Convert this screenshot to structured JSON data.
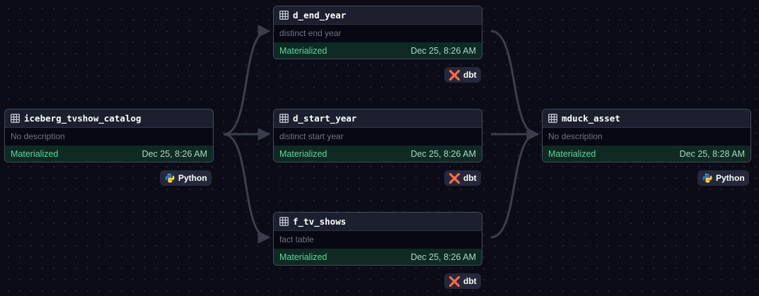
{
  "nodes": [
    {
      "key": "iceberg",
      "name": "iceberg_tvshow_catalog",
      "description": "No description",
      "status": "Materialized",
      "timestamp": "Dec 25, 8:26 AM",
      "badge": "Python",
      "icon": "table-icon"
    },
    {
      "key": "d_end_year",
      "name": "d_end_year",
      "description": "distinct end year",
      "status": "Materialized",
      "timestamp": "Dec 25, 8:26 AM",
      "badge": "dbt",
      "icon": "table-icon"
    },
    {
      "key": "d_start_year",
      "name": "d_start_year",
      "description": "distinct start year",
      "status": "Materialized",
      "timestamp": "Dec 25, 8:26 AM",
      "badge": "dbt",
      "icon": "table-icon"
    },
    {
      "key": "f_tv_shows",
      "name": "f_tv_shows",
      "description": "fact table",
      "status": "Materialized",
      "timestamp": "Dec 25, 8:26 AM",
      "badge": "dbt",
      "icon": "table-icon"
    },
    {
      "key": "mduck",
      "name": "mduck_asset",
      "description": "No description",
      "status": "Materialized",
      "timestamp": "Dec 25, 8:28 AM",
      "badge": "Python",
      "icon": "table-icon"
    }
  ],
  "edges": [
    {
      "from": "iceberg_tvshow_catalog",
      "to": "d_end_year"
    },
    {
      "from": "iceberg_tvshow_catalog",
      "to": "d_start_year"
    },
    {
      "from": "iceberg_tvshow_catalog",
      "to": "f_tv_shows"
    },
    {
      "from": "d_end_year",
      "to": "mduck_asset"
    },
    {
      "from": "d_start_year",
      "to": "mduck_asset"
    },
    {
      "from": "f_tv_shows",
      "to": "mduck_asset"
    }
  ],
  "colors": {
    "background": "#0b0c17",
    "status_bg": "#0f2a23",
    "status_text": "#5fd69a",
    "edge": "#3a3e4c",
    "dbt_orange": "#ff694b",
    "python_blue": "#3776ab",
    "python_yellow": "#ffd343"
  }
}
